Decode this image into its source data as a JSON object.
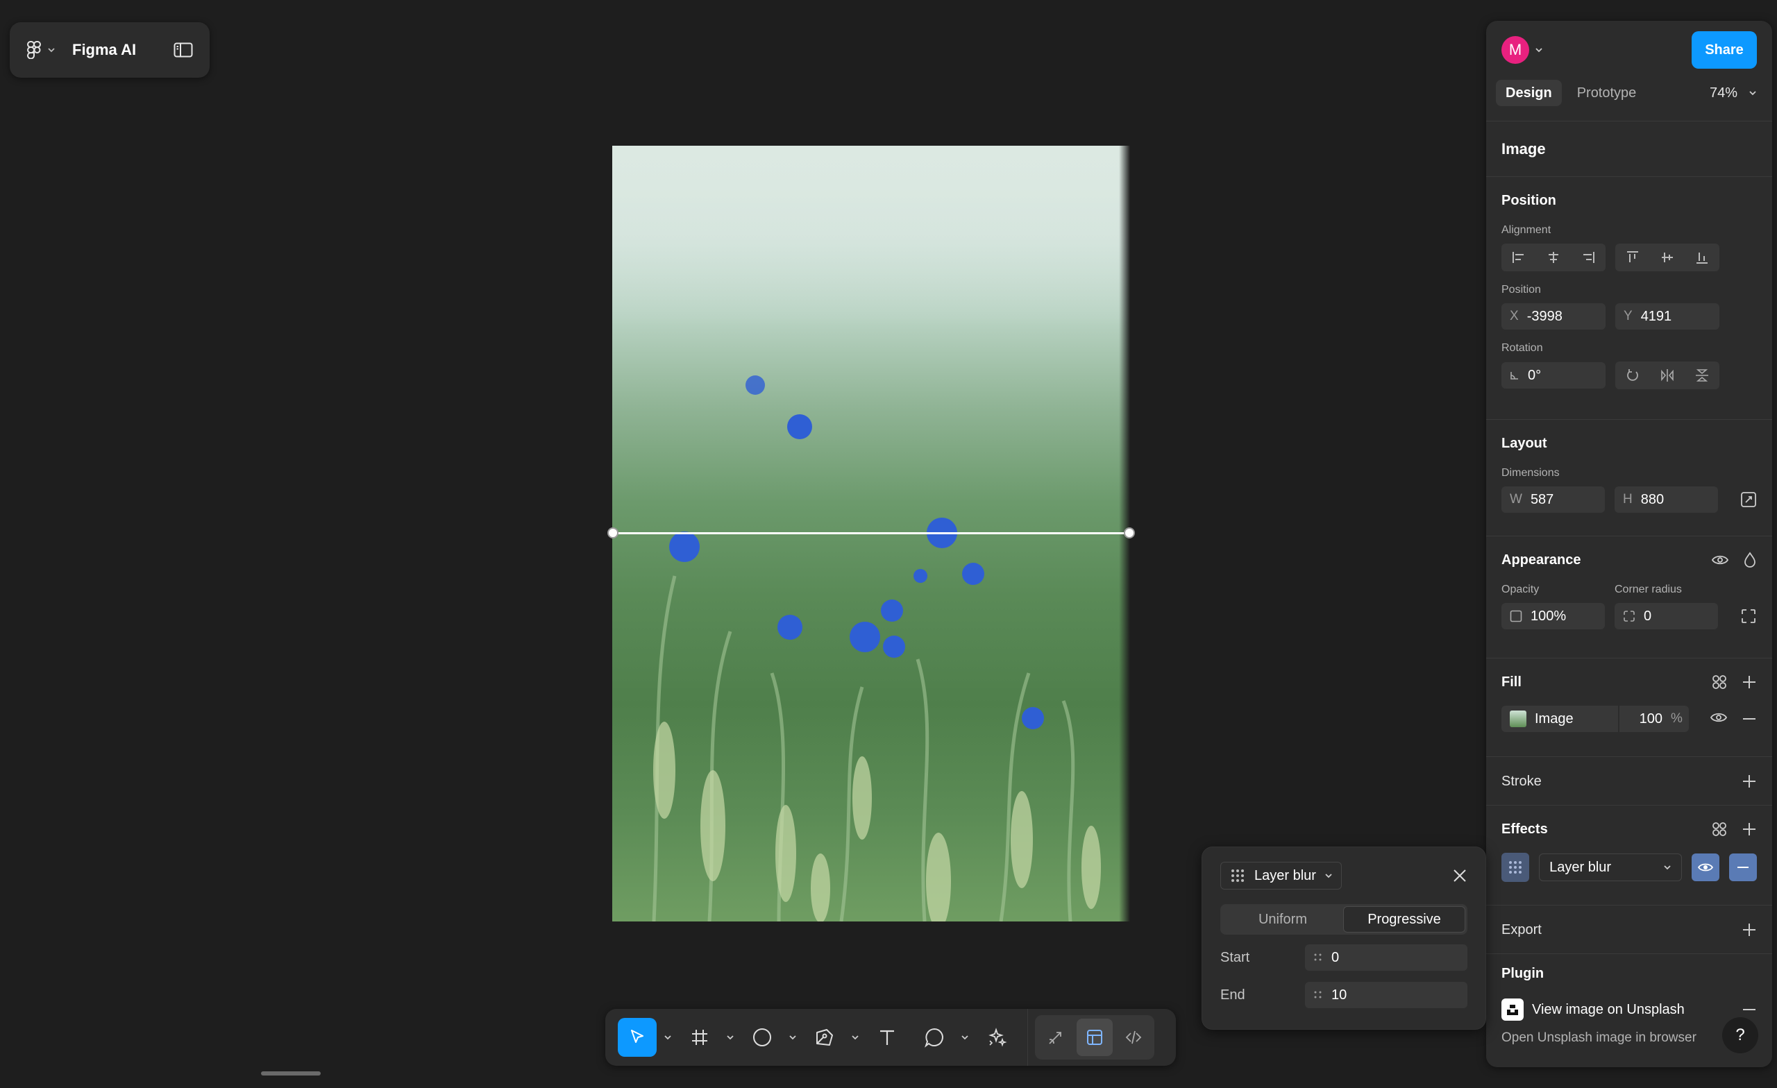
{
  "app": {
    "title": "Figma AI",
    "icons": {
      "menu": "figma-logo-icon",
      "panel_toggle": "sidebar-toggle-icon"
    }
  },
  "header": {
    "avatar_initial": "M",
    "share_label": "Share",
    "tabs": [
      {
        "label": "Design",
        "active": true
      },
      {
        "label": "Prototype",
        "active": false
      }
    ],
    "zoom": "74%"
  },
  "layer": {
    "name": "Image"
  },
  "position": {
    "title": "Position",
    "alignment_label": "Alignment",
    "position_label": "Position",
    "x_prefix": "X",
    "x": "-3998",
    "y_prefix": "Y",
    "y": "4191",
    "rotation_label": "Rotation",
    "rotation": "0°"
  },
  "layout": {
    "title": "Layout",
    "dimensions_label": "Dimensions",
    "w_prefix": "W",
    "w": "587",
    "h_prefix": "H",
    "h": "880"
  },
  "appearance": {
    "title": "Appearance",
    "opacity_label": "Opacity",
    "opacity": "100%",
    "corner_radius_label": "Corner radius",
    "corner_radius": "0"
  },
  "fill": {
    "title": "Fill",
    "type": "Image",
    "opacity": "100",
    "unit": "%"
  },
  "stroke": {
    "title": "Stroke"
  },
  "effects": {
    "title": "Effects",
    "type": "Layer blur"
  },
  "export": {
    "title": "Export"
  },
  "plugin": {
    "title": "Plugin",
    "name": "View image on Unsplash",
    "description": "Open Unsplash image in browser"
  },
  "help": {
    "label": "?"
  },
  "blur_popover": {
    "type": "Layer blur",
    "modes": [
      {
        "label": "Uniform",
        "active": false
      },
      {
        "label": "Progressive",
        "active": true
      }
    ],
    "start_label": "Start",
    "start": "0",
    "end_label": "End",
    "end": "10"
  },
  "toolbar": {
    "tools": [
      "move-tool",
      "frame-tool",
      "shape-tool",
      "pen-tool",
      "text-tool",
      "comment-tool",
      "actions-tool"
    ],
    "modes": [
      "draw-mode",
      "design-mode",
      "dev-mode"
    ],
    "active_tool": "move-tool",
    "active_mode": "design-mode"
  },
  "colors": {
    "canvas": "#1e1e1e",
    "panel": "#2c2c2c",
    "accent": "#0d99ff",
    "avatar": "#e8217f"
  }
}
